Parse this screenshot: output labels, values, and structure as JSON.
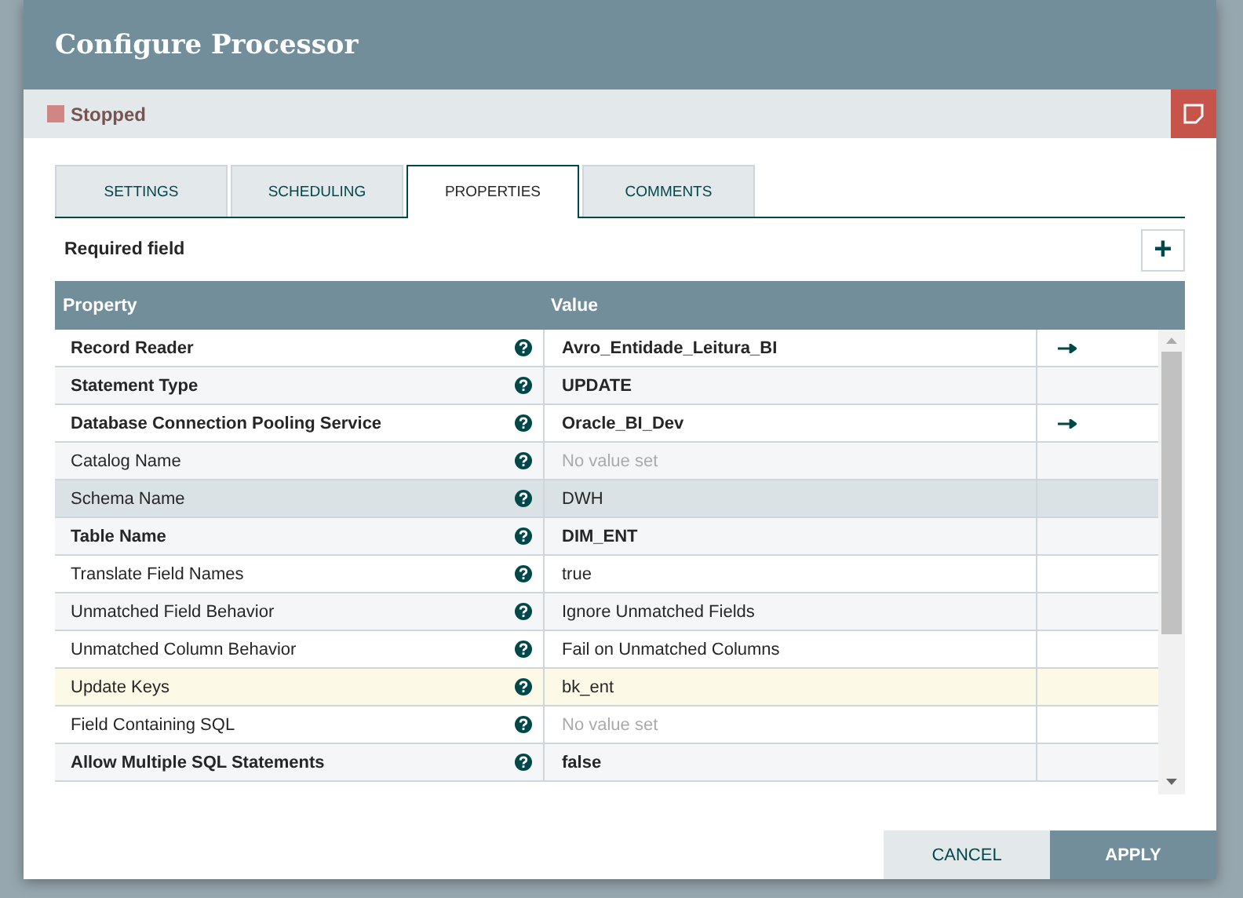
{
  "dialog": {
    "title": "Configure Processor"
  },
  "status": {
    "label": "Stopped",
    "color": "#d18686"
  },
  "tabs": [
    {
      "label": "SETTINGS",
      "selected": false
    },
    {
      "label": "SCHEDULING",
      "selected": false
    },
    {
      "label": "PROPERTIES",
      "selected": true
    },
    {
      "label": "COMMENTS",
      "selected": false
    }
  ],
  "required_note": "Required field",
  "add_button": "+",
  "table": {
    "columns": [
      "Property",
      "Value"
    ],
    "rows": [
      {
        "property": "Record Reader",
        "value": "Avro_Entidade_Leitura_BI",
        "required": true,
        "value_set": true,
        "has_link": true,
        "selected": false,
        "modified": false
      },
      {
        "property": "Statement Type",
        "value": "UPDATE",
        "required": true,
        "value_set": true,
        "has_link": false,
        "selected": false,
        "modified": false
      },
      {
        "property": "Database Connection Pooling Service",
        "value": "Oracle_BI_Dev",
        "required": true,
        "value_set": true,
        "has_link": true,
        "selected": false,
        "modified": false
      },
      {
        "property": "Catalog Name",
        "value": "No value set",
        "required": false,
        "value_set": false,
        "has_link": false,
        "selected": false,
        "modified": false
      },
      {
        "property": "Schema Name",
        "value": "DWH",
        "required": false,
        "value_set": true,
        "has_link": false,
        "selected": true,
        "modified": false
      },
      {
        "property": "Table Name",
        "value": "DIM_ENT",
        "required": true,
        "value_set": true,
        "has_link": false,
        "selected": false,
        "modified": false
      },
      {
        "property": "Translate Field Names",
        "value": "true",
        "required": false,
        "value_set": true,
        "has_link": false,
        "selected": false,
        "modified": false
      },
      {
        "property": "Unmatched Field Behavior",
        "value": "Ignore Unmatched Fields",
        "required": false,
        "value_set": true,
        "has_link": false,
        "selected": false,
        "modified": false
      },
      {
        "property": "Unmatched Column Behavior",
        "value": "Fail on Unmatched Columns",
        "required": false,
        "value_set": true,
        "has_link": false,
        "selected": false,
        "modified": false
      },
      {
        "property": "Update Keys",
        "value": "bk_ent",
        "required": false,
        "value_set": true,
        "has_link": false,
        "selected": false,
        "modified": true
      },
      {
        "property": "Field Containing SQL",
        "value": "No value set",
        "required": false,
        "value_set": false,
        "has_link": false,
        "selected": false,
        "modified": false
      },
      {
        "property": "Allow Multiple SQL Statements",
        "value": "false",
        "required": true,
        "value_set": true,
        "has_link": false,
        "selected": false,
        "modified": false
      }
    ]
  },
  "buttons": [
    {
      "label": "CANCEL",
      "kind": "secondary"
    },
    {
      "label": "APPLY",
      "kind": "primary"
    }
  ]
}
